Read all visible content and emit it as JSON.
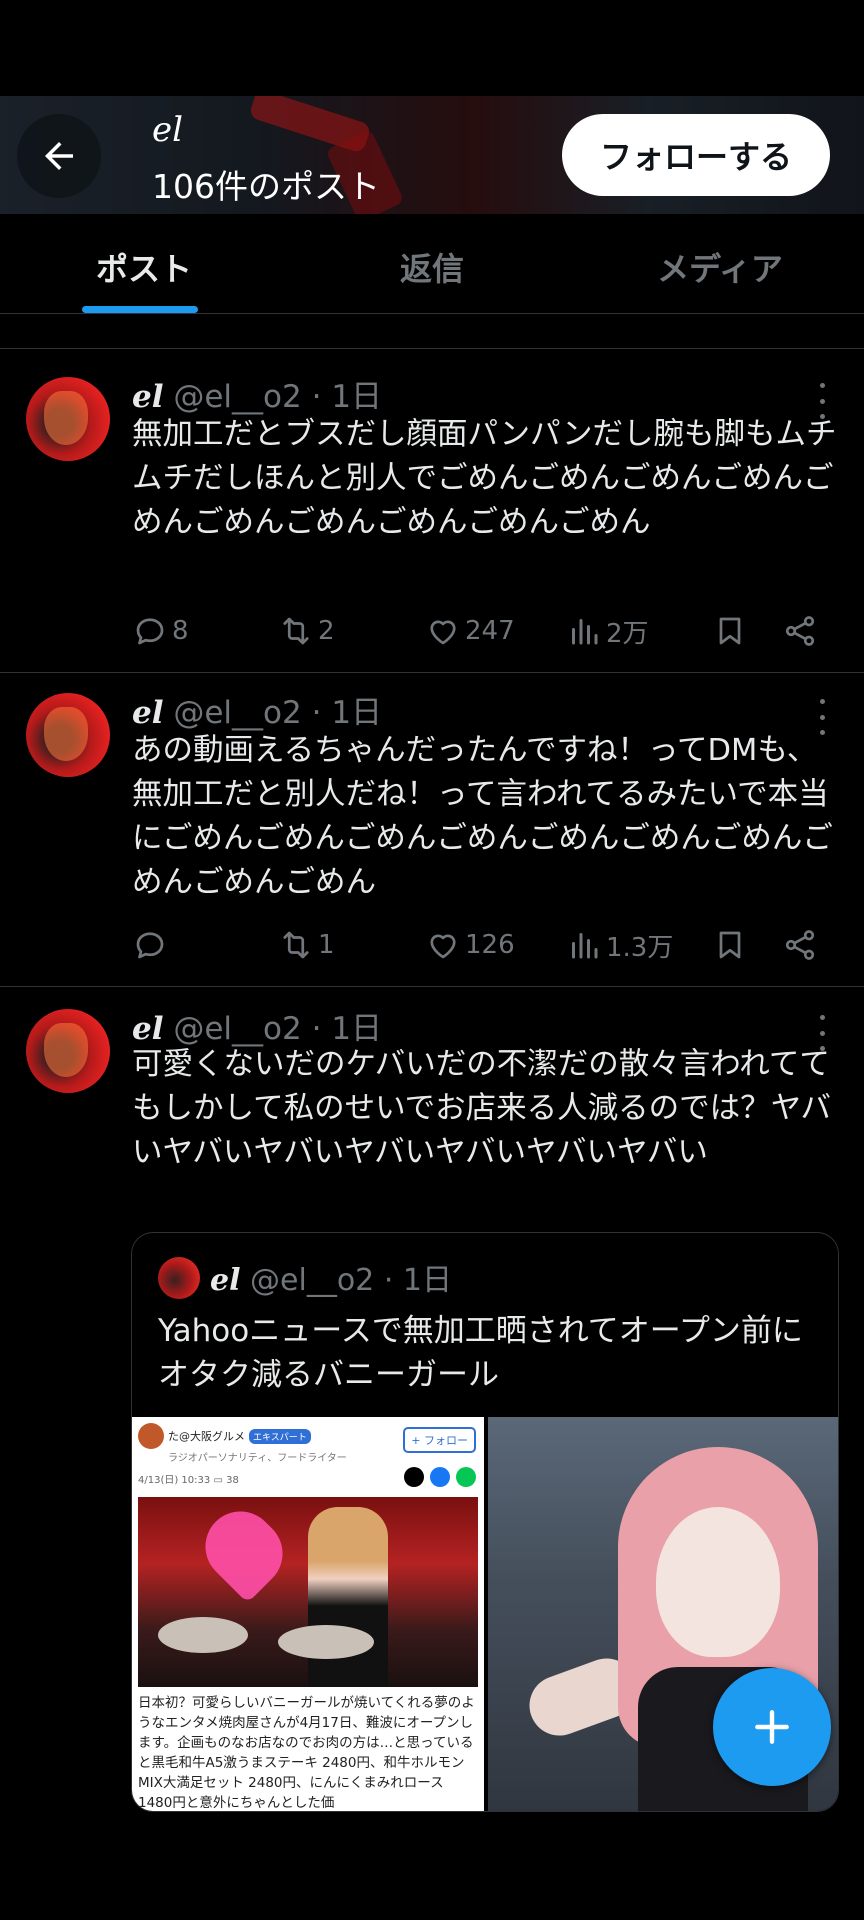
{
  "header": {
    "display_name": "el",
    "post_count": "106件のポスト",
    "follow_label": "フォローする"
  },
  "tabs": [
    {
      "label": "ポスト",
      "active": true
    },
    {
      "label": "返信",
      "active": false
    },
    {
      "label": "メディア",
      "active": false
    }
  ],
  "posts": [
    {
      "name": "el",
      "handle": "@el__o2",
      "time": "1日",
      "text": "無加工だとブスだし顔面パンパンだし腕も脚もムチムチだしほんと別人でごめんごめんごめんごめんごめんごめんごめんごめんごめんごめん",
      "replies": "8",
      "reposts": "2",
      "likes": "247",
      "views": "2万"
    },
    {
      "name": "el",
      "handle": "@el__o2",
      "time": "1日",
      "text": "あの動画えるちゃんだったんですね！ってDMも、無加工だと別人だね！って言われてるみたいで本当にごめんごめんごめんごめんごめんごめんごめんごめんごめんごめん",
      "replies": "",
      "reposts": "1",
      "likes": "126",
      "views": "1.3万"
    },
    {
      "name": "el",
      "handle": "@el__o2",
      "time": "1日",
      "text": "可愛くないだのケバいだの不潔だの散々言われててもしかして私のせいでお店来る人減るのでは？ヤバいヤバいヤバいヤバいヤバいヤバいヤバい",
      "quote": {
        "name": "el",
        "handle": "@el__o2",
        "time": "1日",
        "text": "Yahooニュースで無加工晒されてオープン前にオタク減るバニーガール",
        "article": {
          "source": "た@大阪グルメ",
          "badge": "エキスパート",
          "role": "ラジオパーソナリティ、フードライター",
          "follow": "+ フォロー",
          "date": "4/13(日) 10:33",
          "comments": "38",
          "body": "日本初？可愛らしいバニーガールが焼いてくれる夢のようなエンタメ焼肉屋さんが4月17日、難波にオープンします。企画ものなお店なのでお肉の方は…と思っていると黒毛和牛A5激うまステーキ 2480円、和牛ホルモンMIX大満足セット 2480円、にんにくまみれロース 1480円と意外にちゃんとした価"
        }
      }
    }
  ],
  "colors": {
    "accent": "#1d9bf0",
    "text": "#e7e9ea",
    "muted": "#71767b",
    "divider": "#2f3336"
  },
  "icons": [
    "arrow-left-icon",
    "more-icon",
    "reply-icon",
    "repost-icon",
    "like-icon",
    "views-icon",
    "bookmark-icon",
    "share-icon",
    "compose-plus-icon"
  ]
}
